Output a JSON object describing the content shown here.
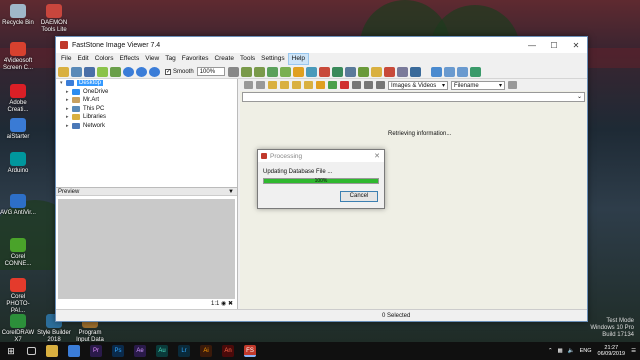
{
  "desktop": {
    "icons": [
      {
        "label": "Recycle Bin",
        "color": "#9fb7c9"
      },
      {
        "label": "DAEMON Tools Lite",
        "color": "#c9463d"
      },
      {
        "label": "4Videosoft Screen C...",
        "color": "#d8412f"
      },
      {
        "label": "Adobe Creati...",
        "color": "#da1f26"
      },
      {
        "label": "aiStarter",
        "color": "#3a7bd5"
      },
      {
        "label": "Arduino",
        "color": "#00979d"
      },
      {
        "label": "AVG AntiVir...",
        "color": "#2d6fc7"
      },
      {
        "label": "Corel CONNE...",
        "color": "#4aa32a"
      },
      {
        "label": "Corel PHOTO-PAI...",
        "color": "#e43b2c"
      },
      {
        "label": "CorelDRAW X7",
        "color": "#2c8f3a"
      },
      {
        "label": "Style Builder 2018",
        "color": "#2c6e9a"
      },
      {
        "label": "Program Input Data",
        "color": "#9a6c2c"
      }
    ]
  },
  "window": {
    "title": "FastStone Image Viewer 7.4",
    "menu": [
      "File",
      "Edit",
      "Colors",
      "Effects",
      "View",
      "Tag",
      "Favorites",
      "Create",
      "Tools",
      "Settings",
      "Help"
    ],
    "smooth_label": "Smooth",
    "zoom_value": "100%",
    "tree": [
      {
        "label": "Desktop",
        "color": "#3b7dd8"
      },
      {
        "label": "OneDrive",
        "color": "#2d8cf0"
      },
      {
        "label": "Mr.Art",
        "color": "#c8a060"
      },
      {
        "label": "This PC",
        "color": "#5a8ab8"
      },
      {
        "label": "Libraries",
        "color": "#d9b040"
      },
      {
        "label": "Network",
        "color": "#4a78b8"
      }
    ],
    "preview_label": "Preview",
    "preview_zoom": "1:1",
    "filter_select": "Images & Videos",
    "sort_select": "Filename",
    "retrieving_text": "Retrieving information...",
    "status_selected": "0 Selected"
  },
  "dialog": {
    "title": "Processing",
    "message": "Updating Database File ...",
    "progress": 100,
    "progress_text": "100%",
    "cancel_label": "Cancel"
  },
  "taskbar": {
    "apps": [
      {
        "label": "Pr",
        "color": "#2a1a4a"
      },
      {
        "label": "Ps",
        "color": "#0a2a4a"
      },
      {
        "label": "Ae",
        "color": "#2a1a4a"
      },
      {
        "label": "Au",
        "color": "#0a3a3a"
      },
      {
        "label": "Lr",
        "color": "#0a2a3a"
      },
      {
        "label": "Ai",
        "color": "#3a1a0a"
      },
      {
        "label": "An",
        "color": "#4a0a0a"
      },
      {
        "label": "FS",
        "color": "#c0392b"
      }
    ],
    "lang": "ENG",
    "time": "21:27",
    "date": "06/09/2019"
  },
  "watermark": {
    "line1": "Test Mode",
    "line2": "Windows 10 Pro",
    "line3": "Build 17134"
  }
}
